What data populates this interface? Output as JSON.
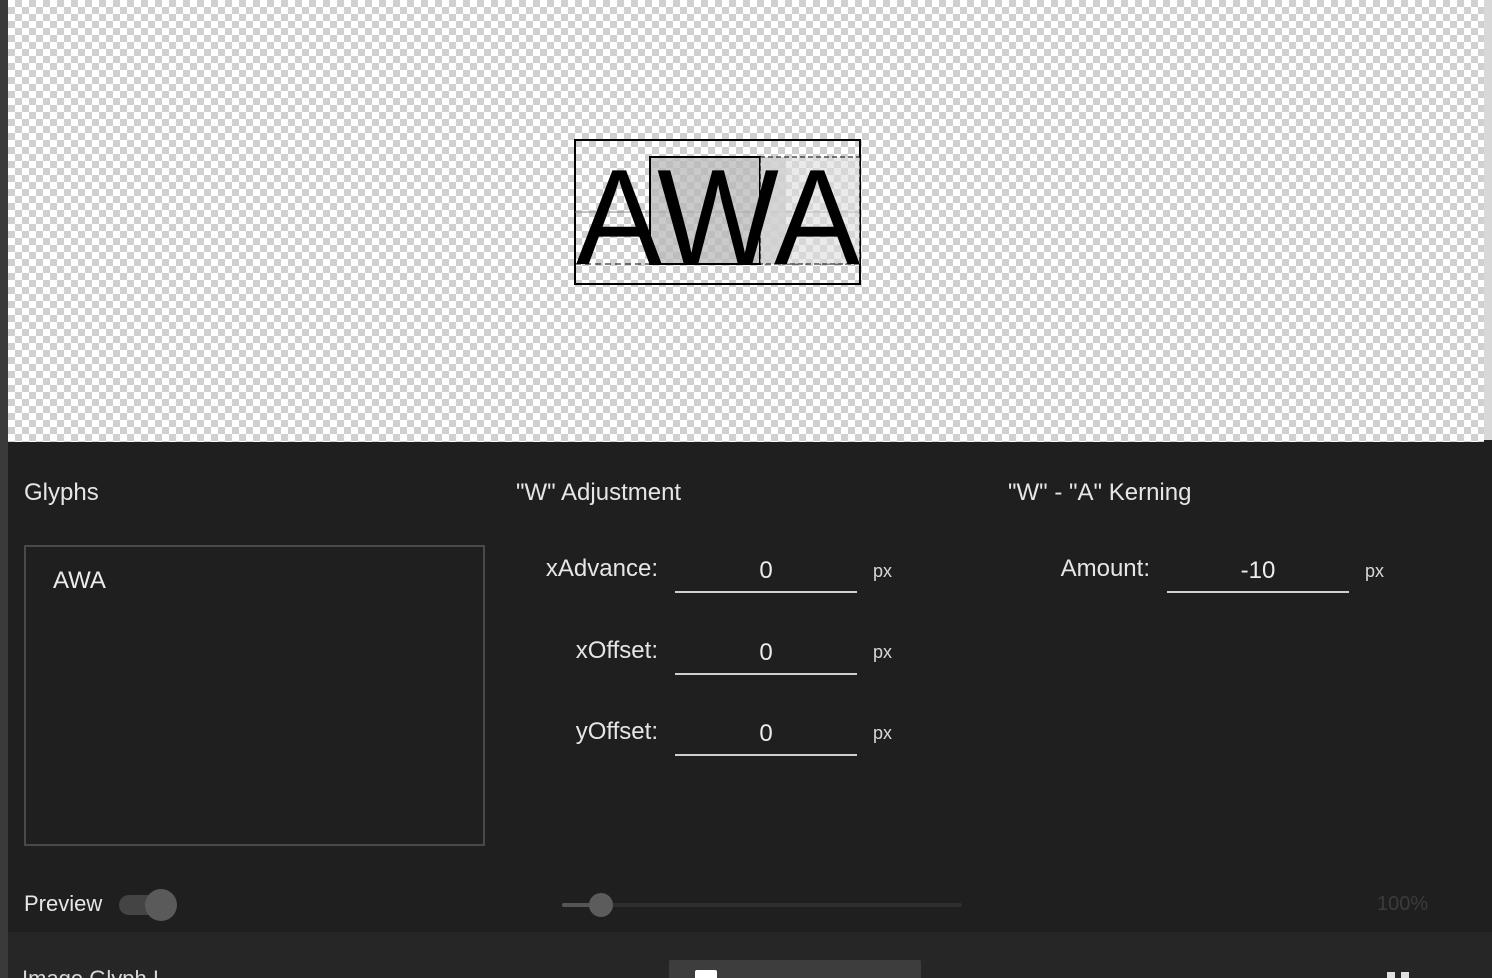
{
  "canvas": {
    "preview_text": "AWA",
    "background": "checkerboard"
  },
  "glyphs_panel": {
    "title": "Glyphs",
    "text": "AWA"
  },
  "adjustment_panel": {
    "title": "\"W\" Adjustment",
    "fields": [
      {
        "label": "xAdvance:",
        "value": "0",
        "unit": "px"
      },
      {
        "label": "xOffset:",
        "value": "0",
        "unit": "px"
      },
      {
        "label": "yOffset:",
        "value": "0",
        "unit": "px"
      }
    ]
  },
  "kerning_panel": {
    "title": "\"W\" - \"A\" Kerning",
    "amount_label": "Amount:",
    "amount_value": "-10",
    "amount_unit": "px"
  },
  "bottom_bar": {
    "preview_label": "Preview",
    "preview_toggle_on": false,
    "zoom_readout": "100%",
    "zoom_fraction": 0.1
  },
  "footer": {
    "partial_label": "Image Glyph I"
  },
  "colors": {
    "panel_bg": "#1f1f1f",
    "text": "#e6e6e6",
    "input_underline": "#cfcfcf",
    "selection_fill": "#b0b0b0"
  }
}
